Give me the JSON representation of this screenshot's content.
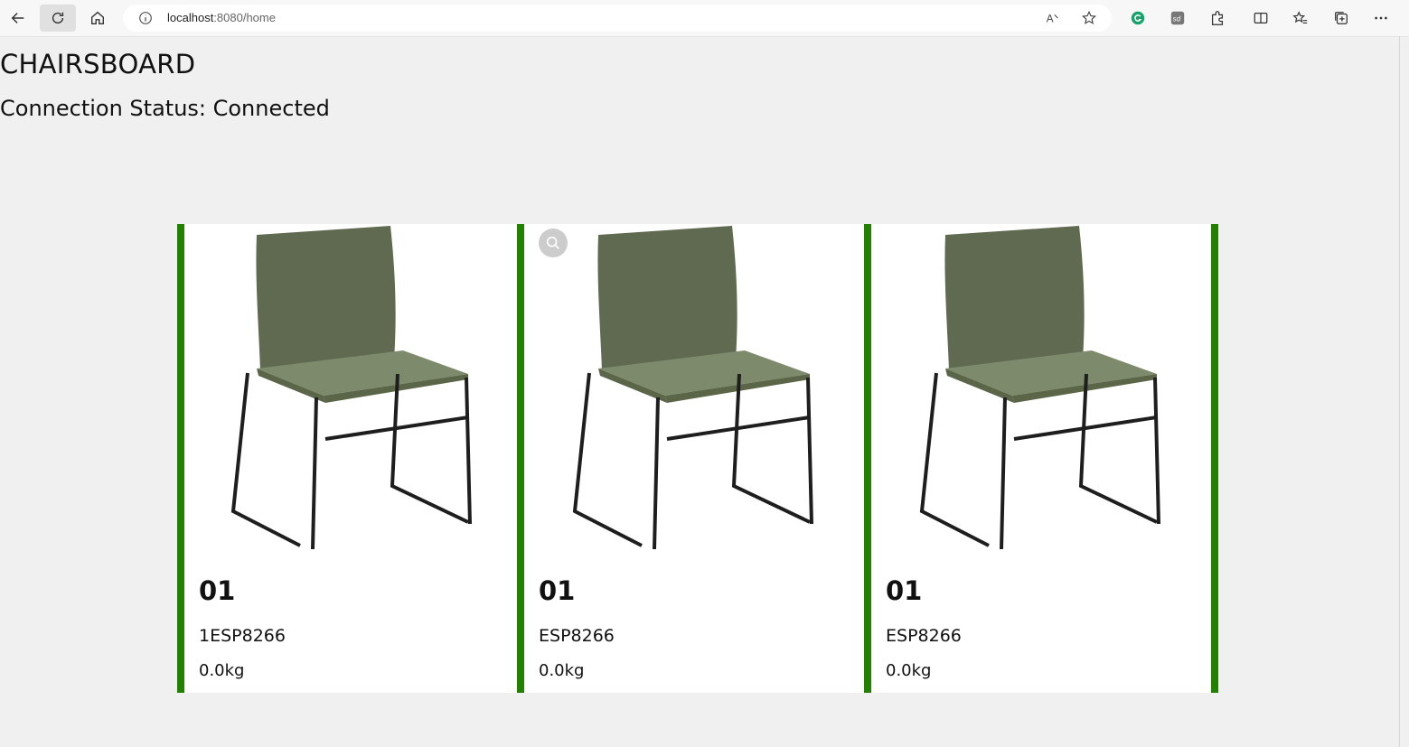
{
  "browser": {
    "url_host": "localhost",
    "url_path": ":8080/home",
    "icons": [
      "back-icon",
      "reload-icon",
      "home-icon",
      "info-icon",
      "read-aloud-icon",
      "favorite-icon",
      "grammarly-icon",
      "sd-extension-icon",
      "extensions-icon",
      "split-screen-icon",
      "favorites-icon",
      "collections-icon",
      "more-icon"
    ]
  },
  "page": {
    "title": "CHAIRSBOARD",
    "status": "Connection Status: Connected"
  },
  "cards": [
    {
      "title": "01",
      "device": "1ESP8266",
      "weight": "0.0kg"
    },
    {
      "title": "01",
      "device": "ESP8266",
      "weight": "0.0kg"
    },
    {
      "title": "01",
      "device": "ESP8266",
      "weight": "0.0kg"
    }
  ],
  "colors": {
    "accent": "#228200",
    "chair_shell": "#6b7558",
    "background": "#f0f0f0"
  }
}
